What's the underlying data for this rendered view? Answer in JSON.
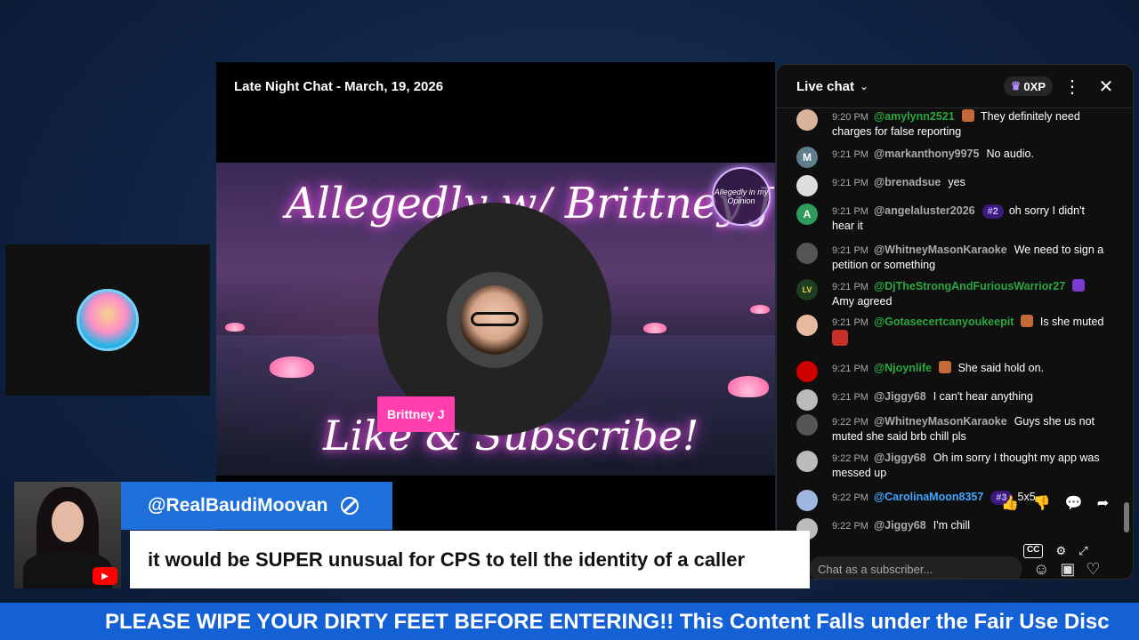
{
  "stage": {
    "title": "Late Night Chat - March, 19, 2026",
    "banner_title": "Allegedly w/ Brittney J",
    "banner_subtitle": "Like & Subscribe!",
    "logo_text": "Allegedly in my Opinion",
    "guest_name": "Brittney J"
  },
  "chat": {
    "title": "Live chat",
    "xp": "0XP",
    "input_placeholder": "Chat as a subscriber...",
    "messages": [
      {
        "time": "9:20 PM",
        "author": "@amylynn2521",
        "text": "They definitely need charges for false reporting"
      },
      {
        "time": "9:21 PM",
        "author": "@markanthony9975",
        "text": "No audio.",
        "initial": "M"
      },
      {
        "time": "9:21 PM",
        "author": "@brenadsue",
        "text": "yes"
      },
      {
        "time": "9:21 PM",
        "author": "@angelaluster2026",
        "rank": "#2",
        "text": "oh sorry I didn't hear it",
        "initial": "A"
      },
      {
        "time": "9:21 PM",
        "author": "@WhitneyMasonKaraoke",
        "text": "We need to sign a petition or something"
      },
      {
        "time": "9:21 PM",
        "author": "@DjTheStrongAndFuriousWarrior27",
        "text": "Amy agreed"
      },
      {
        "time": "9:21 PM",
        "author": "@Gotasecertcanyoukeepit",
        "text": "Is she muted"
      },
      {
        "time": "9:21 PM",
        "author": "@Njoynlife",
        "text": "She said hold on."
      },
      {
        "time": "9:21 PM",
        "author": "@Jiggy68",
        "text": "I can't hear anything"
      },
      {
        "time": "9:22 PM",
        "author": "@WhitneyMasonKaraoke",
        "text": "Guys she us not muted she said brb chill pls"
      },
      {
        "time": "9:22 PM",
        "author": "@Jiggy68",
        "text": "Oh im sorry I thought my app was messed up"
      },
      {
        "time": "9:22 PM",
        "author": "@CarolinaMoon8357",
        "rank": "#3",
        "text": "5x5"
      },
      {
        "time": "9:22 PM",
        "author": "@Jiggy68",
        "text": "I'm chill"
      }
    ]
  },
  "overlay": {
    "handle": "@RealBaudiMoovan",
    "comment": "it would be SUPER unusual for CPS to tell the identity of a caller",
    "ticker": "PLEASE WIPE YOUR DIRTY FEET BEFORE ENTERING!! This Content Falls under the Fair Use Disc"
  },
  "colors": {
    "accent_blue": "#1e6fd9",
    "ticker_blue": "#1461d6",
    "name_tag_pink": "#ff3fae",
    "member_green": "#2ba640"
  }
}
